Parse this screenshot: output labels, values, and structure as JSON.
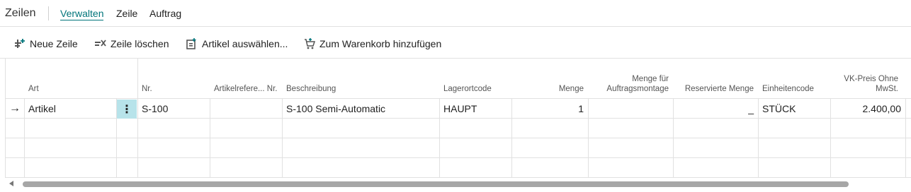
{
  "header": {
    "title": "Zeilen",
    "tabs": [
      {
        "label": "Verwalten",
        "active": true
      },
      {
        "label": "Zeile",
        "active": false
      },
      {
        "label": "Auftrag",
        "active": false
      }
    ]
  },
  "actions": [
    {
      "label": "Neue Zeile",
      "icon": "new-line-icon"
    },
    {
      "label": "Zeile löschen",
      "icon": "delete-line-icon"
    },
    {
      "label": "Artikel auswählen...",
      "icon": "select-items-icon"
    },
    {
      "label": "Zum Warenkorb hinzufügen",
      "icon": "add-to-cart-icon"
    }
  ],
  "table": {
    "columns": [
      {
        "key": "art",
        "label": "Art"
      },
      {
        "key": "nr",
        "label": "Nr."
      },
      {
        "key": "artikelref",
        "label": "Artikelrefere... Nr."
      },
      {
        "key": "beschreibung",
        "label": "Beschreibung"
      },
      {
        "key": "lagerort",
        "label": "Lagerortcode"
      },
      {
        "key": "menge",
        "label": "Menge"
      },
      {
        "key": "auftragsmontage",
        "label": "Menge für Auftragsmontage"
      },
      {
        "key": "reserviert",
        "label": "Reservierte Menge"
      },
      {
        "key": "einheit",
        "label": "Einheitencode"
      },
      {
        "key": "vkpreis",
        "label": "VK-Preis Ohne MwSt."
      }
    ],
    "rows": [
      {
        "indicator": "→",
        "art": "Artikel",
        "nr": "S-100",
        "artikelref": "",
        "beschreibung": "S-100 Semi-Automatic",
        "lagerort": "HAUPT",
        "menge": "1",
        "auftragsmontage": "",
        "reserviert": "_",
        "einheit": "STÜCK",
        "vkpreis": "2.400,00"
      }
    ],
    "empty_rows": 3
  },
  "colors": {
    "accent": "#00747a",
    "selected_cell": "#b7e3ea",
    "border": "#e1e1e1"
  }
}
